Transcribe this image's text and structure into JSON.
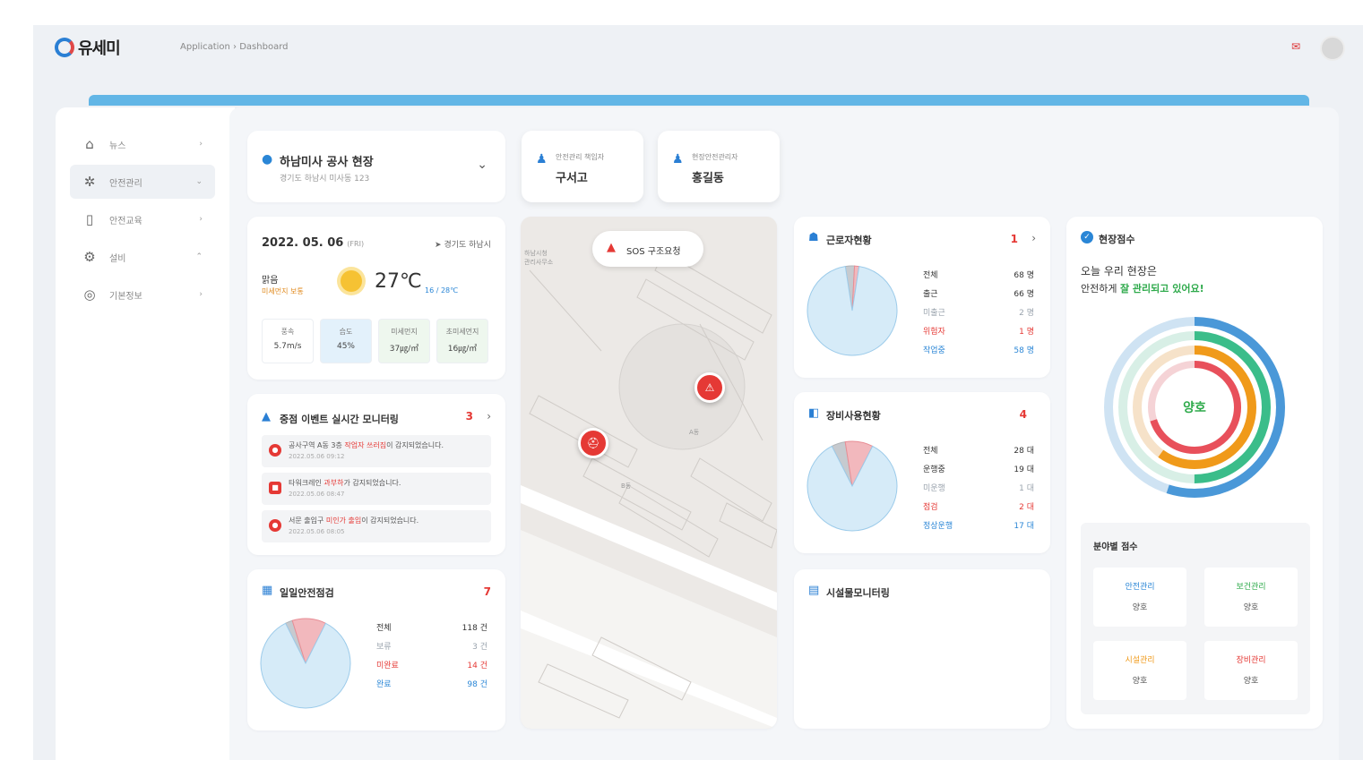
{
  "header": {
    "logo_text": "유세미",
    "breadcrumb": "Application › Dashboard"
  },
  "sidebar": {
    "items": [
      {
        "label": "뉴스",
        "icon": "home-icon",
        "arrow": "›"
      },
      {
        "label": "안전관리",
        "icon": "settings-icon",
        "arrow": "⌄"
      },
      {
        "label": "안전교육",
        "icon": "book-icon",
        "arrow": "›"
      },
      {
        "label": "설비",
        "icon": "gear-icon",
        "arrow": "⌃"
      },
      {
        "label": "기본정보",
        "icon": "info-icon",
        "arrow": "›"
      }
    ]
  },
  "site": {
    "name": "하남미사 공사 현장",
    "address": "경기도 하남시 미사동 123",
    "chevron": "⌄"
  },
  "persons": [
    {
      "role": "안전관리 책임자",
      "name": "구서고"
    },
    {
      "role": "현장안전관리자",
      "name": "홍길동"
    }
  ],
  "weather": {
    "date": "2022. 05. 06",
    "day": "(FRI)",
    "location": "경기도 하남시",
    "now_label": "맑음",
    "now_sub": "미세먼지 보통",
    "temp": "27℃",
    "range": "16 / 28℃",
    "stats": [
      {
        "label": "풍속",
        "value": "5.7m/s"
      },
      {
        "label": "습도",
        "value": "45%"
      },
      {
        "label": "미세먼지",
        "value": "37㎍/㎥"
      },
      {
        "label": "초미세먼지",
        "value": "16㎍/㎥"
      }
    ]
  },
  "events": {
    "title": "중점 이벤트 실시간 모니터링",
    "count": "3",
    "arrow": "›",
    "items": [
      {
        "pre": "공사구역 A동 3층 ",
        "hl": "작업자 쓰러짐",
        "post": "이 감지되었습니다.",
        "time": "2022.05.06 09:12"
      },
      {
        "pre": "타워크레인 ",
        "hl": "과부하",
        "post": "가 감지되었습니다.",
        "time": "2022.05.06 08:47"
      },
      {
        "pre": "서문 출입구 ",
        "hl": "미인가 출입",
        "post": "이 감지되었습니다.",
        "time": "2022.05.06 08:05"
      }
    ]
  },
  "daily": {
    "title": "일일안전점검",
    "count": "7",
    "legend": [
      {
        "label": "전체",
        "value": "118 건",
        "color": "#333333"
      },
      {
        "label": "보류",
        "value": "3 건",
        "color": "#9aa3ad"
      },
      {
        "label": "미완료",
        "value": "14 건",
        "color": "#e53935"
      },
      {
        "label": "완료",
        "value": "98 건",
        "color": "#2a86d6"
      }
    ],
    "chart_data": {
      "type": "pie",
      "categories": [
        "완료",
        "보류",
        "미완료"
      ],
      "values": [
        98,
        3,
        14
      ]
    }
  },
  "map": {
    "sos_label": "SOS 구조요청",
    "labels": [
      {
        "text": "하남시청",
        "sub": "관리사무소"
      },
      {
        "text": "A동"
      },
      {
        "text": "B동"
      }
    ],
    "markers": [
      {
        "icon": "⚠",
        "name": "sos"
      },
      {
        "icon": "⛑",
        "name": "worker"
      }
    ]
  },
  "workers": {
    "title": "근로자현황",
    "count": "1",
    "arrow": "›",
    "legend": [
      {
        "label": "전체",
        "value": "68 명",
        "color": "#333333"
      },
      {
        "label": "출근",
        "value": "66 명",
        "color": "#333333"
      },
      {
        "label": "미출근",
        "value": "2 명",
        "color": "#9aa3ad"
      },
      {
        "label": "위험자",
        "value": "1 명",
        "color": "#e53935"
      },
      {
        "label": "작업중",
        "value": "58 명",
        "color": "#2a86d6"
      }
    ],
    "chart_data": {
      "type": "pie",
      "categories": [
        "작업중",
        "미출근",
        "위험자"
      ],
      "values": [
        58,
        2,
        1
      ]
    }
  },
  "equipment": {
    "title": "장비사용현황",
    "count": "4",
    "legend": [
      {
        "label": "전체",
        "value": "28 대",
        "color": "#333333"
      },
      {
        "label": "운행중",
        "value": "19 대",
        "color": "#333333"
      },
      {
        "label": "미운행",
        "value": "1 대",
        "color": "#9aa3ad"
      },
      {
        "label": "점검",
        "value": "2 대",
        "color": "#e53935"
      },
      {
        "label": "정상운행",
        "value": "17 대",
        "color": "#2a86d6"
      }
    ],
    "chart_data": {
      "type": "pie",
      "categories": [
        "정상운행",
        "미운행",
        "점검"
      ],
      "values": [
        17,
        1,
        2
      ]
    }
  },
  "facility": {
    "title": "시설물모니터링"
  },
  "score": {
    "title": "현장점수",
    "msg1": "오늘 우리 현장은",
    "msg2_pre": "안전하게 ",
    "msg2_hl": "잘 관리되고 있어요!",
    "center": "양호",
    "rings": [
      {
        "name": "안전관리",
        "value": 0.55,
        "color": "#4a98d8"
      },
      {
        "name": "보건관리",
        "value": 0.5,
        "color": "#3bbd8a"
      },
      {
        "name": "시설관리",
        "value": 0.6,
        "color": "#f09a1a"
      },
      {
        "name": "장비관리",
        "value": 0.7,
        "color": "#e8505b"
      }
    ],
    "sub_title": "분야별 점수",
    "sub_items": [
      {
        "label": "안전관리",
        "value": "양호",
        "color": "#2a86d6"
      },
      {
        "label": "보건관리",
        "value": "양호",
        "color": "#2eaa4b"
      },
      {
        "label": "시설관리",
        "value": "양호",
        "color": "#f09a1a"
      },
      {
        "label": "장비관리",
        "value": "양호",
        "color": "#e53935"
      }
    ]
  }
}
